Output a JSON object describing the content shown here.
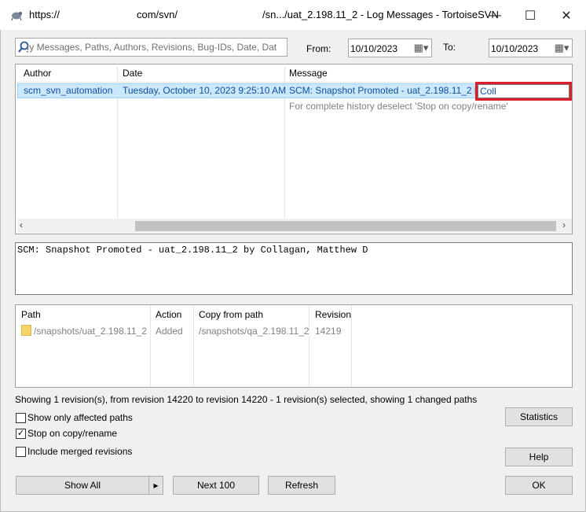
{
  "window": {
    "title_left": "https://",
    "title_mid": "com/svn/",
    "title_right": "/sn.../uat_2.198.11_2 - Log Messages - TortoiseSVN",
    "controls": {
      "minimize": "—",
      "maximize": "☐",
      "close": "✕"
    }
  },
  "filter": {
    "placeholder": "ıy Messages, Paths, Authors, Revisions, Bug-IDs, Date, Dat",
    "from_label": "From:",
    "from_value": "10/10/2023",
    "to_label": "To:",
    "to_value": "10/10/2023"
  },
  "log_table": {
    "columns": [
      "Author",
      "Date",
      "Message"
    ],
    "rows": [
      {
        "author": "scm_svn_automation",
        "date": "Tuesday, October 10, 2023 9:25:10 AM",
        "message": "SCM: Snapshot Promoted - uat_2.198.11_2 by",
        "edit_text": "Coll"
      }
    ],
    "hint": "For complete history deselect 'Stop on copy/rename'"
  },
  "message_text": "SCM: Snapshot Promoted - uat_2.198.11_2 by Collagan, Matthew D",
  "paths_table": {
    "columns": [
      "Path",
      "Action",
      "Copy from path",
      "Revision"
    ],
    "rows": [
      {
        "path": "/snapshots/uat_2.198.11_2",
        "action": "Added",
        "copy_from": "/snapshots/qa_2.198.11_2",
        "revision": "14219"
      }
    ]
  },
  "status_text": "Showing 1 revision(s), from revision 14220 to revision 14220 - 1 revision(s) selected, showing 1 changed paths",
  "options": [
    {
      "label": "Show only affected paths",
      "checked": false
    },
    {
      "label": "Stop on copy/rename",
      "checked": true
    },
    {
      "label": "Include merged revisions",
      "checked": false
    }
  ],
  "buttons": {
    "statistics": "Statistics",
    "help": "Help",
    "show_all": "Show All",
    "next_100": "Next 100",
    "refresh": "Refresh",
    "ok": "OK"
  },
  "colors": {
    "selection": "#cce8ff",
    "highlight_box": "#d9202c",
    "selected_text": "#0b4f9a"
  }
}
